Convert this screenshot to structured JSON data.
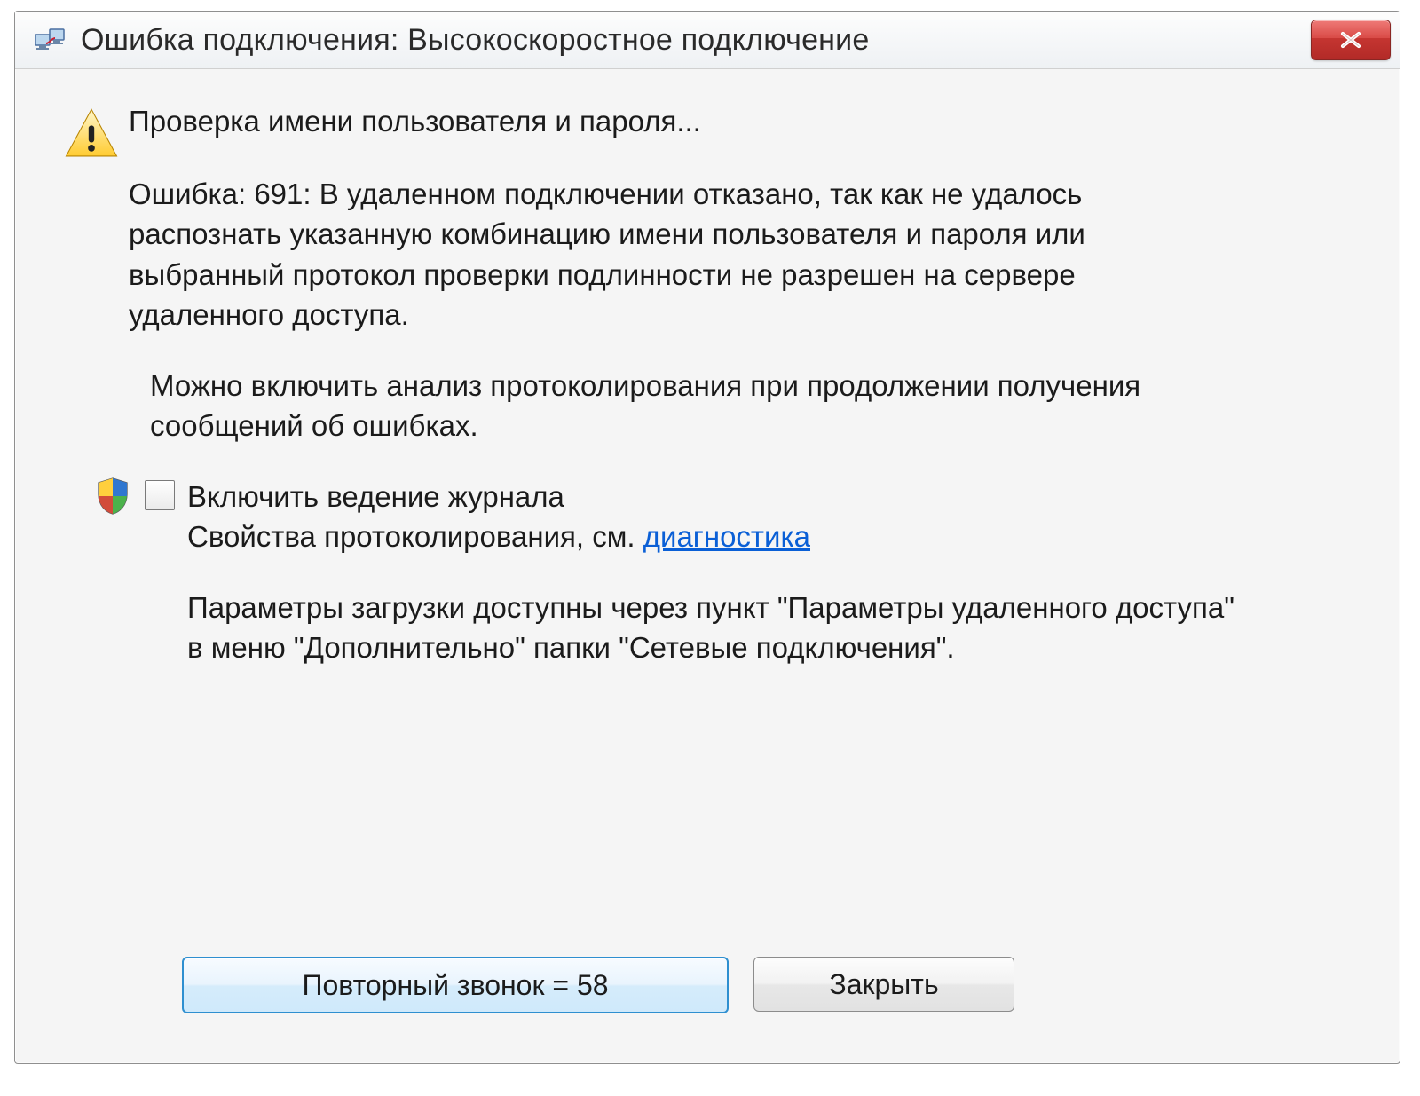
{
  "titlebar": {
    "title": "Ошибка подключения: Высокоскоростное подключение",
    "icon_name": "network-connection-icon",
    "close_icon": "close-icon"
  },
  "main": {
    "heading": "Проверка имени пользователя и пароля...",
    "error_text": "Ошибка: 691: В удаленном подключении отказано, так как не удалось распознать указанную комбинацию имени пользователя и пароля или выбранный протокол проверки подлинности не разрешен на сервере удаленного доступа.",
    "logging_hint": "Можно включить анализ протоколирования при продолжении получения сообщений об ошибках.",
    "checkbox_label": "Включить ведение журнала",
    "diag_prefix": "Свойства протоколирования, см. ",
    "diag_link": "диагностика",
    "params_text": "Параметры загрузки доступны через пункт \"Параметры удаленного доступа\" в меню \"Дополнительно\" папки \"Сетевые подключения\"."
  },
  "buttons": {
    "redial": "Повторный звонок = 58",
    "close": "Закрыть"
  },
  "error_code": 691,
  "redial_countdown": 58
}
